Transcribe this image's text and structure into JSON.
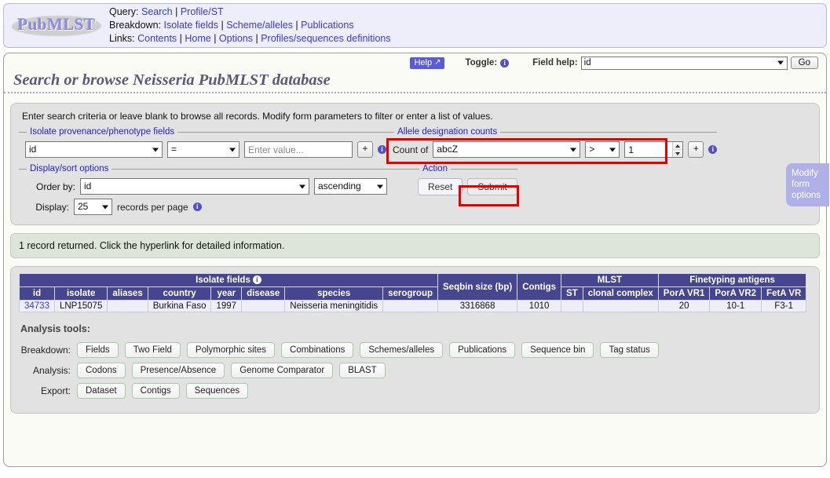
{
  "header": {
    "logo_text": "PubMLST",
    "rows": [
      {
        "label": "Query:",
        "links": [
          "Search",
          "Profile/ST"
        ]
      },
      {
        "label": "Breakdown:",
        "links": [
          "Isolate fields",
          "Scheme/alleles",
          "Publications"
        ]
      },
      {
        "label": "Links:",
        "links": [
          "Contents",
          "Home",
          "Options",
          "Profiles/sequences definitions"
        ]
      }
    ]
  },
  "toolbar": {
    "help_label": "Help",
    "help_icon": "external-link-icon",
    "toggle_label": "Toggle:",
    "toggle_icon": "info-icon",
    "field_help_label": "Field help:",
    "field_help_value": "id",
    "go_label": "Go"
  },
  "page_title": "Search or browse Neisseria PubMLST database",
  "search": {
    "intro": "Enter search criteria or leave blank to browse all records. Modify form parameters to filter or enter a list of values.",
    "provenance": {
      "legend": "Isolate provenance/phenotype fields",
      "field_value": "id",
      "operator_value": "=",
      "value_placeholder": "Enter value...",
      "value_text": "",
      "add_label": "+",
      "info_icon": "info-icon"
    },
    "allele_counts": {
      "legend": "Allele designation counts",
      "count_of_label": "Count of",
      "locus_value": "abcZ",
      "comparator_value": ">",
      "number_value": "1",
      "add_label": "+",
      "info_icon": "info-icon",
      "highlight_color": "#e60000"
    },
    "display_options": {
      "legend": "Display/sort options",
      "order_by_label": "Order by:",
      "order_by_value": "id",
      "direction_value": "ascending",
      "display_label": "Display:",
      "records_value": "25",
      "records_suffix": "records per page",
      "info_icon": "info-icon"
    },
    "action": {
      "legend": "Action",
      "reset_label": "Reset",
      "submit_label": "Submit",
      "highlight_color": "#e60000"
    },
    "modify_tab_label": "Modify form options"
  },
  "result_message": "1 record returned. Click the hyperlink for detailed information.",
  "results_table": {
    "group_headers": [
      {
        "label": "Isolate fields",
        "span": 9,
        "info_icon": "info-icon"
      },
      {
        "label": "",
        "span": 1
      },
      {
        "label": "",
        "span": 1
      },
      {
        "label": "MLST",
        "span": 2
      },
      {
        "label": "Finetyping antigens",
        "span": 3
      }
    ],
    "columns": [
      "id",
      "isolate",
      "aliases",
      "country",
      "year",
      "disease",
      "species",
      "serogroup",
      "Seqbin size (bp)",
      "Contigs",
      "ST",
      "clonal complex",
      "PorA VR1",
      "PorA VR2",
      "FetA VR"
    ],
    "rows": [
      {
        "id": "34733",
        "isolate": "LNP15075",
        "aliases": "",
        "country": "Burkina Faso",
        "year": "1997",
        "disease": "",
        "species": "Neisseria meningitidis",
        "serogroup": "",
        "seqbin_size": "3316868",
        "contigs": "1010",
        "st": "",
        "clonal_complex": "",
        "pora_vr1": "20",
        "pora_vr2": "10-1",
        "feta_vr": "F3-1"
      }
    ]
  },
  "analysis_tools": {
    "title": "Analysis tools:",
    "groups": [
      {
        "label": "Breakdown:",
        "buttons": [
          "Fields",
          "Two Field",
          "Polymorphic sites",
          "Combinations",
          "Schemes/alleles",
          "Publications",
          "Sequence bin",
          "Tag status"
        ]
      },
      {
        "label": "Analysis:",
        "buttons": [
          "Codons",
          "Presence/Absence",
          "Genome Comparator",
          "BLAST"
        ]
      },
      {
        "label": "Export:",
        "buttons": [
          "Dataset",
          "Contigs",
          "Sequences"
        ]
      }
    ]
  }
}
